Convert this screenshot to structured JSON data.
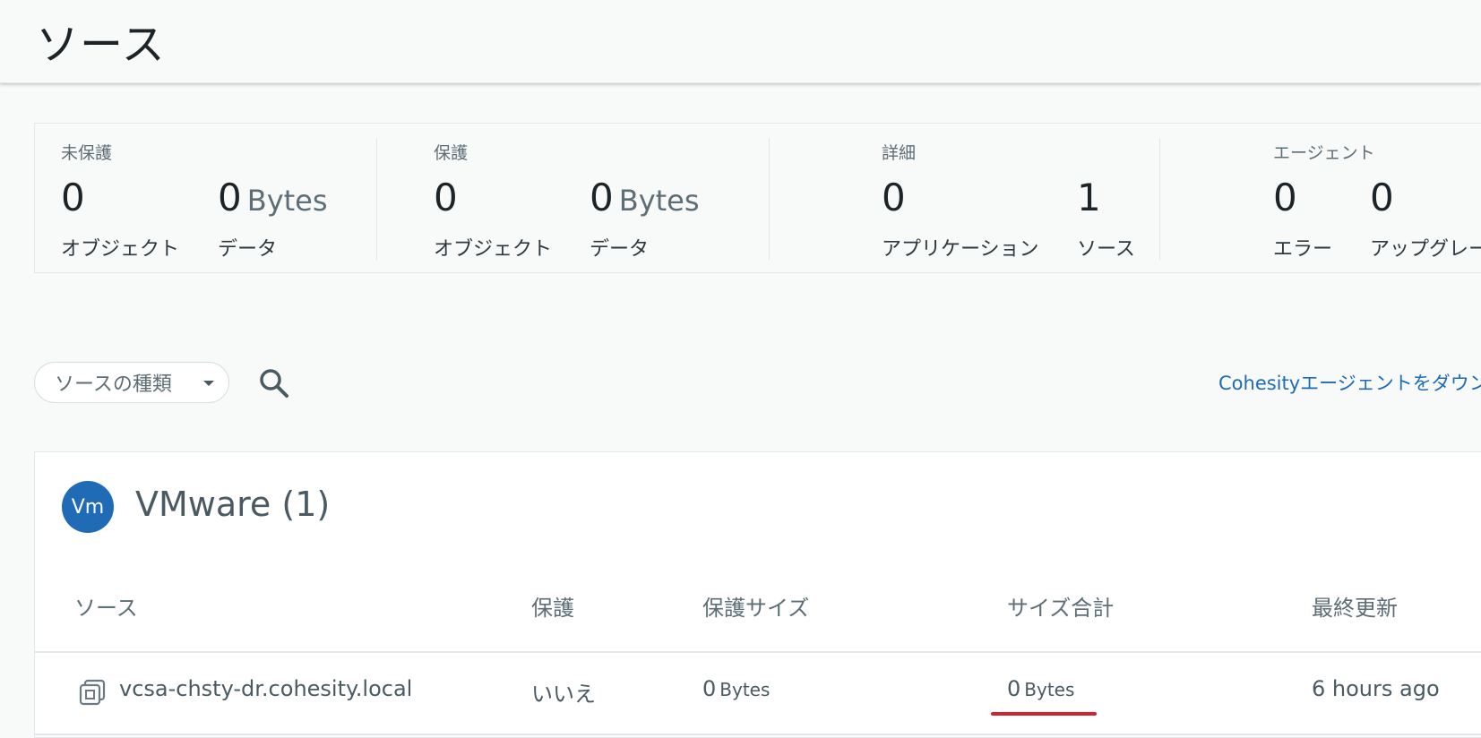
{
  "page": {
    "title": "ソース"
  },
  "stats": {
    "unprotected": {
      "label": "未保護",
      "objects_value": "0",
      "objects_caption": "オブジェクト",
      "data_value": "0",
      "data_unit": "Bytes",
      "data_caption": "データ"
    },
    "protected": {
      "label": "保護",
      "objects_value": "0",
      "objects_caption": "オブジェクト",
      "data_value": "0",
      "data_unit": "Bytes",
      "data_caption": "データ"
    },
    "details": {
      "label": "詳細",
      "applications_value": "0",
      "applications_caption": "アプリケーション",
      "sources_value": "1",
      "sources_caption": "ソース"
    },
    "agents": {
      "label": "エージェント",
      "errors_value": "0",
      "errors_caption": "エラー",
      "upgradable_value": "0",
      "upgradable_caption": "アップグレード可"
    }
  },
  "toolbar": {
    "source_type_dropdown": "ソースの種類",
    "search_icon": "search-icon",
    "download_link": "Cohesityエージェントをダウン"
  },
  "vmware_section": {
    "avatar_text": "Vm",
    "avatar_color": "#1f6bb5",
    "title": "VMware (1)",
    "columns": [
      "ソース",
      "保護",
      "保護サイズ",
      "サイズ合計",
      "最終更新"
    ],
    "rows": [
      {
        "icon": "vm-icon",
        "source": "vcsa-chsty-dr.cohesity.local",
        "protected": "いいえ",
        "protected_size_value": "0",
        "protected_size_unit": "Bytes",
        "total_size_value": "0",
        "total_size_unit": "Bytes",
        "last_updated": "6 hours ago"
      }
    ]
  },
  "colors": {
    "accent": "#1f6bb5",
    "highlight": "#d0232d"
  }
}
